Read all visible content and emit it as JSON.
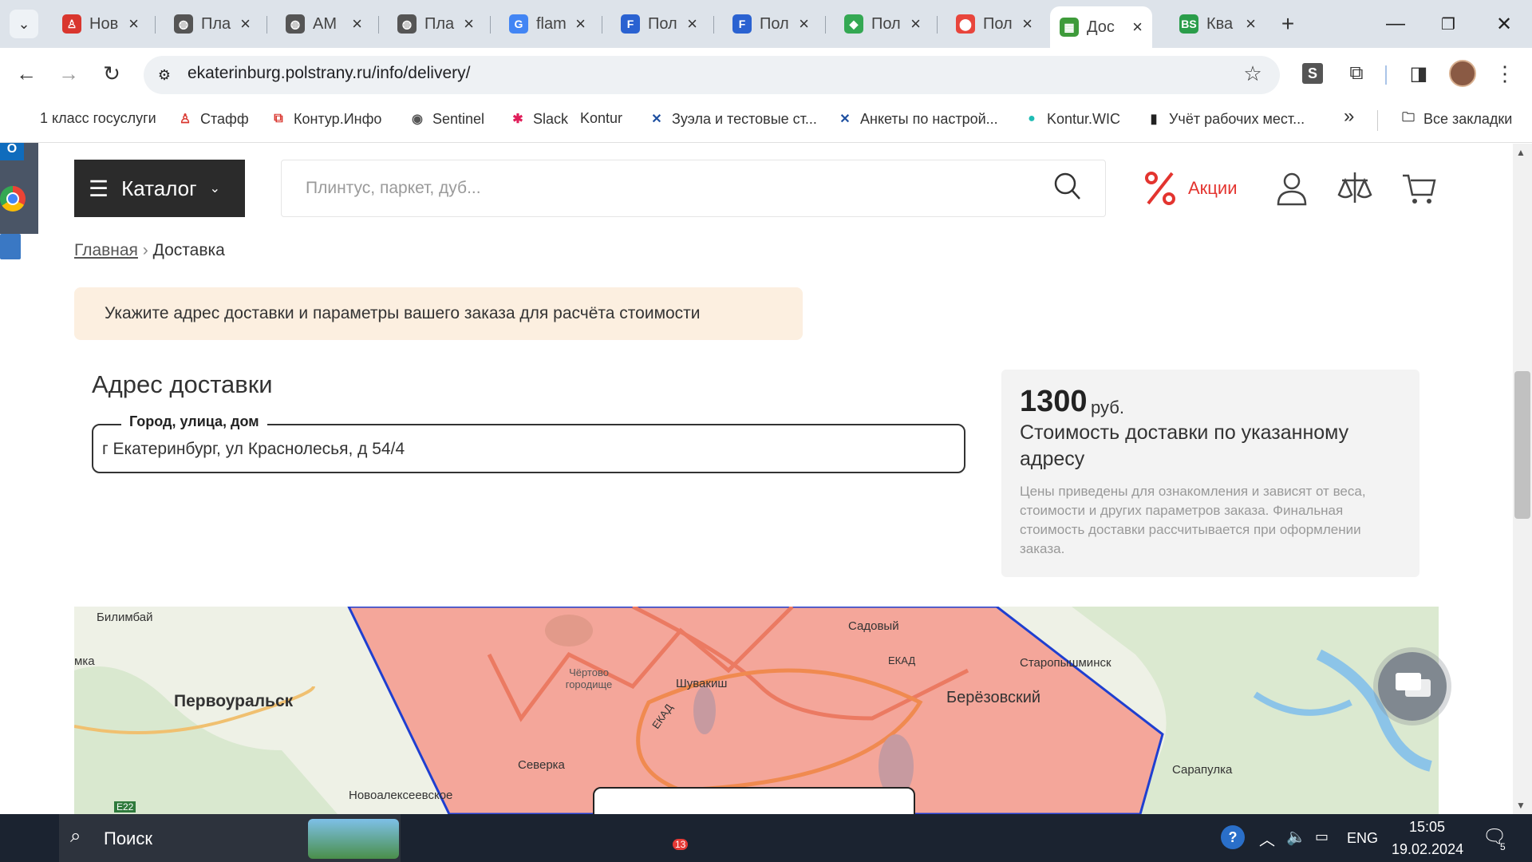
{
  "browser": {
    "tabs": [
      {
        "title": "Нов",
        "icon": "person-icon",
        "color": "#d9362e"
      },
      {
        "title": "Пла",
        "icon": "globe-icon",
        "color": "#555"
      },
      {
        "title": "АМ",
        "icon": "globe-icon",
        "color": "#555"
      },
      {
        "title": "Пла",
        "icon": "globe-icon",
        "color": "#555"
      },
      {
        "title": "flam",
        "icon": "google-icon",
        "color": "#4285f4"
      },
      {
        "title": "Пол",
        "icon": "doc-icon",
        "color": "#2a62d1"
      },
      {
        "title": "Пол",
        "icon": "doc-icon",
        "color": "#2a62d1"
      },
      {
        "title": "Пол",
        "icon": "maps-icon",
        "color": "#34a853"
      },
      {
        "title": "Пол",
        "icon": "pin-icon",
        "color": "#e8453c"
      },
      {
        "title": "Дос",
        "icon": "site-icon",
        "color": "#3e9b3a"
      },
      {
        "title": "Ква",
        "icon": "bs-icon",
        "color": "#2a9d4a"
      }
    ],
    "url": "ekaterinburg.polstrany.ru/info/delivery/",
    "bookmarks": [
      "1 класс госуслуги",
      "Стафф",
      "Контур.Инфо",
      "Sentinel",
      "Slack",
      "Kontur",
      "Зуэла и тестовые ст...",
      "Анкеты по настрой...",
      "Kontur.WIC",
      "Учёт рабочих мест..."
    ],
    "bookmarks_more": "»",
    "all_bookmarks": "Все закладки"
  },
  "page": {
    "catalog_label": "Каталог",
    "search_placeholder": "Плинтус, паркет, дуб...",
    "promo_label": "Акции",
    "breadcrumb": {
      "home": "Главная",
      "sep": "›",
      "current": "Доставка"
    },
    "notice": "Укажите адрес доставки и параметры вашего заказа для расчёта стоимости",
    "address_title": "Адрес доставки",
    "field_label": "Город, улица, дом",
    "field_value": "г Екатеринбург, ул Краснолесья, д 54/4",
    "price": "1300",
    "price_currency": "руб.",
    "price_label": "Стоимость доставки по указанному адресу",
    "price_note": "Цены приведены для ознакомления и зависят от веса, стоимости и других параметров заказа. Финальная стоимость доставки рассчитывается при оформлении заказа.",
    "accent_color": "#e3342f"
  },
  "map": {
    "labels": [
      "Билимбай",
      "мка",
      "Первоуральск",
      "Чёртово городище",
      "Шувакиш",
      "ЕКАД",
      "Садовый",
      "ЕКАД",
      "Старопышминск",
      "Берёзовский",
      "Северка",
      "Новоалексеевское",
      "Сарапулка",
      "E22"
    ]
  },
  "taskbar": {
    "search_label": "Поиск",
    "telegram_badge": "13",
    "lang": "ENG",
    "time": "15:05",
    "date": "19.02.2024",
    "notif_count": "5"
  }
}
